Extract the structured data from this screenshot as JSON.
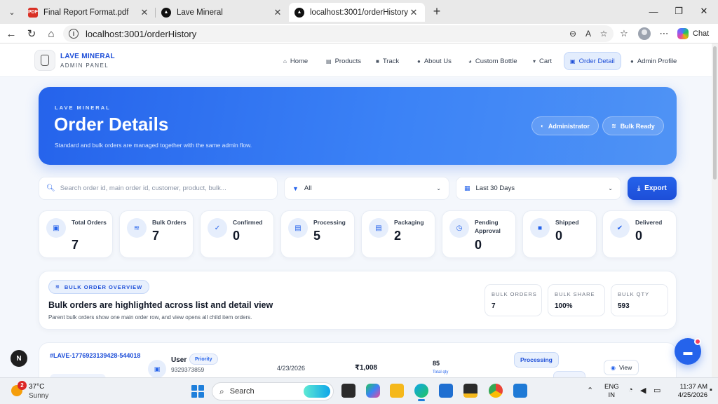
{
  "browser": {
    "tabs": [
      {
        "title": "Final Report Format.pdf",
        "favicon": "pdf-icon",
        "active": false
      },
      {
        "title": "Lave Mineral",
        "favicon": "app-logo-icon",
        "active": false
      },
      {
        "title": "localhost:3001/orderHistory",
        "favicon": "app-logo-icon",
        "active": true
      }
    ],
    "url": "localhost:3001/orderHistory",
    "chat_label": "Chat"
  },
  "app": {
    "brand_name": "LAVE MINERAL",
    "brand_sub": "ADMIN PANEL",
    "nav": [
      {
        "label": "Home",
        "icon": "home-icon",
        "active": false
      },
      {
        "label": "Products",
        "icon": "box-icon",
        "active": false
      },
      {
        "label": "Track",
        "icon": "truck-icon",
        "active": false
      },
      {
        "label": "About Us",
        "icon": "info-icon",
        "active": false
      },
      {
        "label": "Custom Bottle",
        "icon": "palette-icon",
        "active": false
      },
      {
        "label": "Cart",
        "icon": "cart-icon",
        "active": false
      },
      {
        "label": "Order Detail",
        "icon": "clipboard-icon",
        "active": true
      },
      {
        "label": "Admin Profile",
        "icon": "user-icon",
        "active": false
      }
    ]
  },
  "hero": {
    "kicker": "LAVE MINERAL",
    "title": "Order Details",
    "subtitle": "Standard and bulk orders are managed together with the same admin flow.",
    "pill_admin": "Administrator",
    "pill_bulk": "Bulk Ready"
  },
  "filters": {
    "search_placeholder": "Search order id, main order id, customer, product, bulk...",
    "status_value": "All",
    "date_value": "Last 30 Days",
    "export_label": "Export"
  },
  "stats": [
    {
      "label": "Total Orders",
      "value": "7",
      "icon": "clipboard-icon"
    },
    {
      "label": "Bulk Orders",
      "value": "7",
      "icon": "layers-icon"
    },
    {
      "label": "Confirmed",
      "value": "0",
      "icon": "check-icon"
    },
    {
      "label": "Processing",
      "value": "5",
      "icon": "box-icon"
    },
    {
      "label": "Packaging",
      "value": "2",
      "icon": "box-icon"
    },
    {
      "label": "Pending Approval",
      "value": "0",
      "icon": "clock-icon"
    },
    {
      "label": "Shipped",
      "value": "0",
      "icon": "truck-icon"
    },
    {
      "label": "Delivered",
      "value": "0",
      "icon": "check-circle-icon"
    }
  ],
  "overview": {
    "badge": "BULK ORDER OVERVIEW",
    "title": "Bulk orders are highlighted across list and detail view",
    "subtitle": "Parent bulk orders show one main order row, and view opens all child item orders.",
    "boxes": [
      {
        "label": "BULK ORDERS",
        "value": "7"
      },
      {
        "label": "BULK SHARE",
        "value": "100%"
      },
      {
        "label": "BULK QTY",
        "value": "593"
      }
    ]
  },
  "order": {
    "id": "#LAVE-1776923139428-544018",
    "user": "User",
    "priority": "Priority",
    "phone": "9329373859",
    "date": "4/23/2026",
    "amount": "₹1,008",
    "qty": "85",
    "qty_label": "Total qty",
    "status": "Processing",
    "view_label": "View"
  },
  "taskbar": {
    "temp": "37°C",
    "condition": "Sunny",
    "weather_badge": "2",
    "search_label": "Search",
    "lang_1": "ENG",
    "lang_2": "IN",
    "time": "11:37 AM",
    "date": "4/25/2026"
  }
}
